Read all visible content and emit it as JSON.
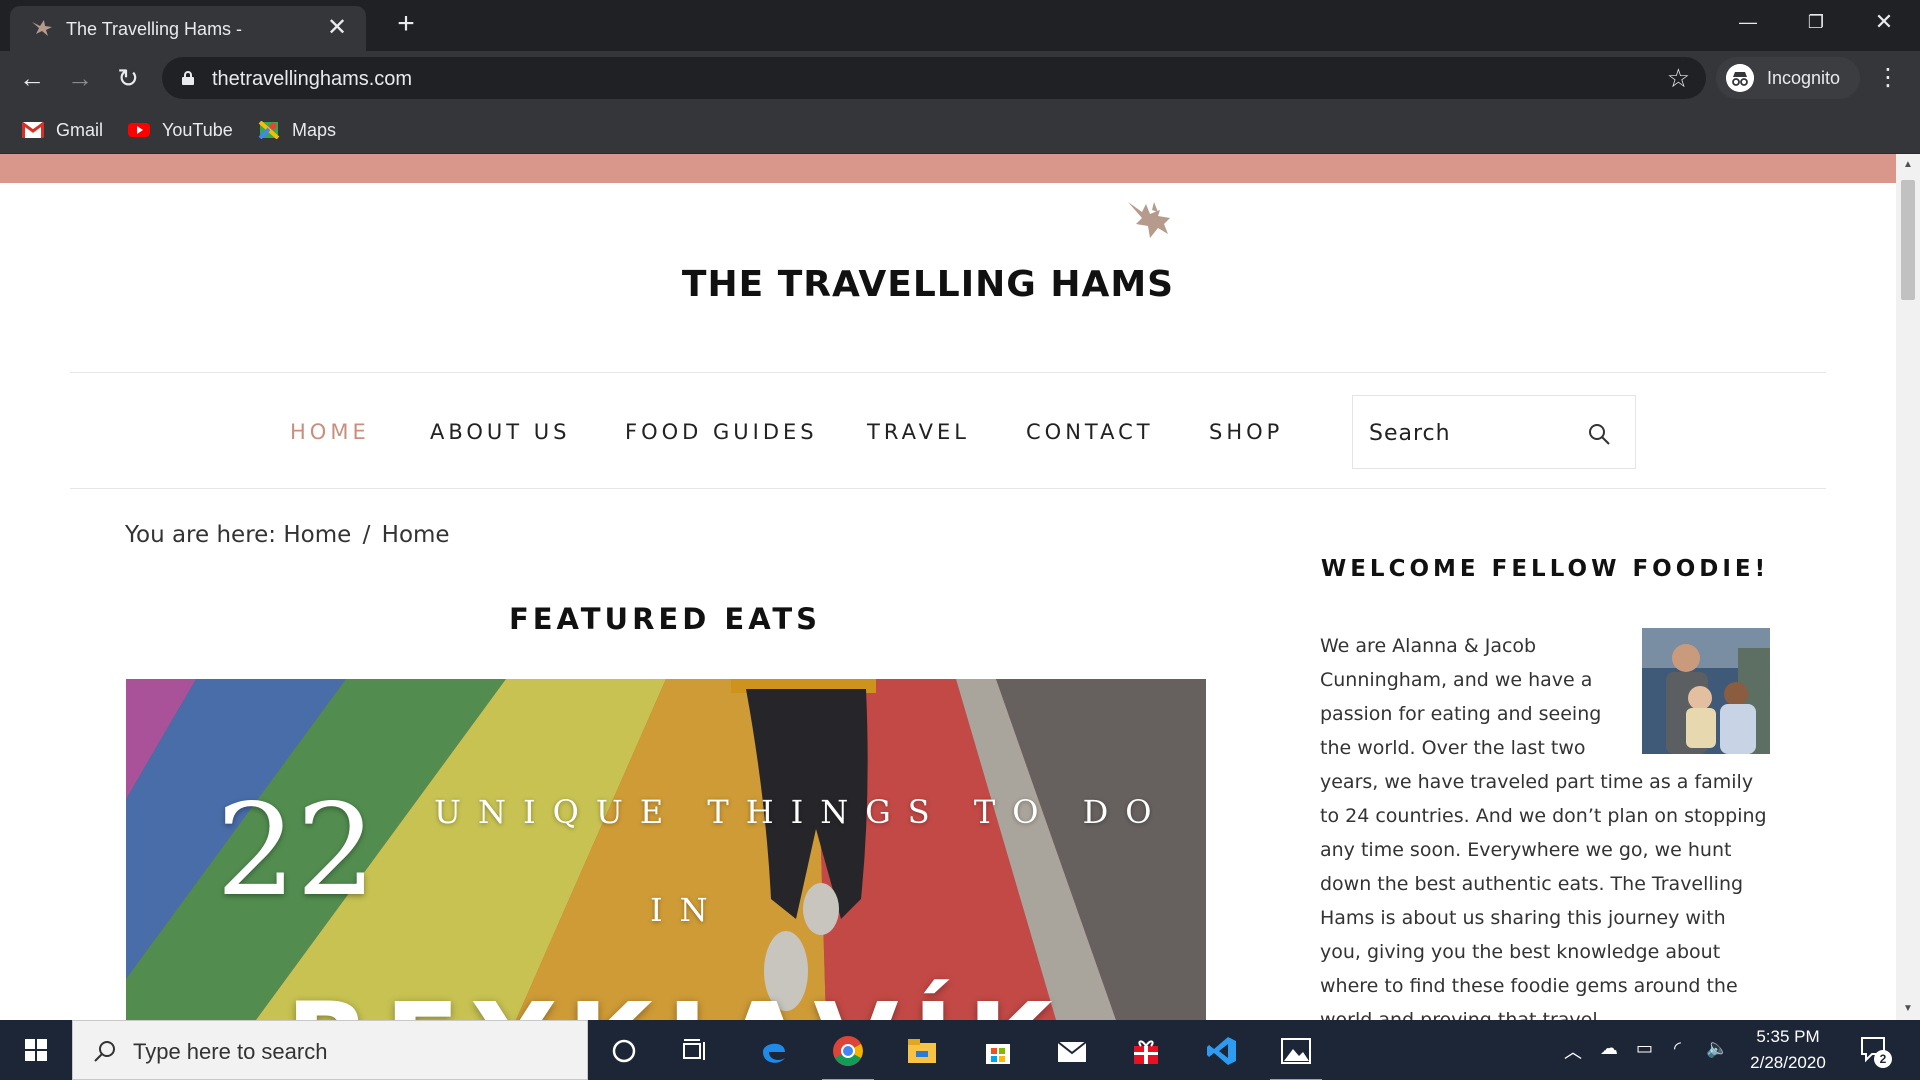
{
  "browser": {
    "tab_title": "The Travelling Hams -",
    "new_tab": "+",
    "url": "thetravellinghams.com",
    "profile_label": "Incognito",
    "bookmarks": [
      {
        "label": "Gmail",
        "icon": "gmail-icon"
      },
      {
        "label": "YouTube",
        "icon": "youtube-icon"
      },
      {
        "label": "Maps",
        "icon": "maps-icon"
      }
    ]
  },
  "site": {
    "title": "THE TRAVELLING HAMS",
    "accent_color": "#d8978a",
    "nav": [
      {
        "label": "HOME",
        "active": true
      },
      {
        "label": "ABOUT US",
        "active": false
      },
      {
        "label": "FOOD GUIDES",
        "active": false
      },
      {
        "label": "TRAVEL",
        "active": false
      },
      {
        "label": "CONTACT",
        "active": false
      },
      {
        "label": "SHOP",
        "active": false
      }
    ],
    "search_placeholder": "Search",
    "breadcrumb": {
      "prefix": "You are here:",
      "items": [
        "Home",
        "Home"
      ],
      "separator": "/"
    },
    "featured_heading": "FEATURED EATS",
    "hero": {
      "number": "22",
      "line1": "UNIQUE THINGS TO DO",
      "line2": "IN",
      "city": "REYKJAVÍK"
    },
    "sidebar": {
      "heading": "WELCOME FELLOW FOODIE!",
      "bio": "We are Alanna & Jacob Cunningham, and we have a passion for eating and seeing the world. Over the last two years, we have traveled part time as a family to 24 countries. And we don’t plan on stopping any time soon. Everywhere we go, we hunt down the best authentic eats. The Travelling Hams is about us sharing this journey with you, giving you the best knowledge about where to find these foodie gems around the world and proving that travel"
    }
  },
  "taskbar": {
    "search_placeholder": "Type here to search",
    "time": "5:35 PM",
    "date": "2/28/2020",
    "notification_count": "2"
  }
}
